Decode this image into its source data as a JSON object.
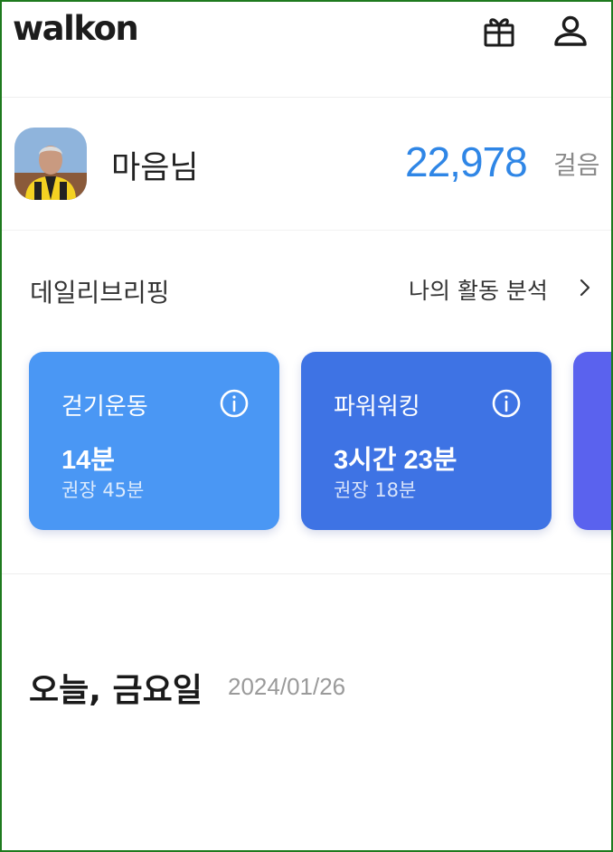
{
  "header": {
    "logo_text": "walkon",
    "gift_icon": "gift-icon",
    "profile_icon": "user-icon"
  },
  "profile": {
    "name": "마음님",
    "steps": "22,978",
    "steps_unit": "걸음"
  },
  "briefing": {
    "title": "데일리브리핑",
    "analysis_link": "나의 활동 분석",
    "cards": [
      {
        "title": "걷기운동",
        "value": "14분",
        "recommended": "권장 45분",
        "color": "#4a97f4"
      },
      {
        "title": "파워워킹",
        "value": "3시간 23분",
        "recommended": "권장 18분",
        "color": "#3e73e4"
      }
    ]
  },
  "today": {
    "label": "오늘, 금요일",
    "date": "2024/01/26"
  },
  "colors": {
    "accent": "#2f86e6",
    "frame": "#1e7a1e"
  }
}
